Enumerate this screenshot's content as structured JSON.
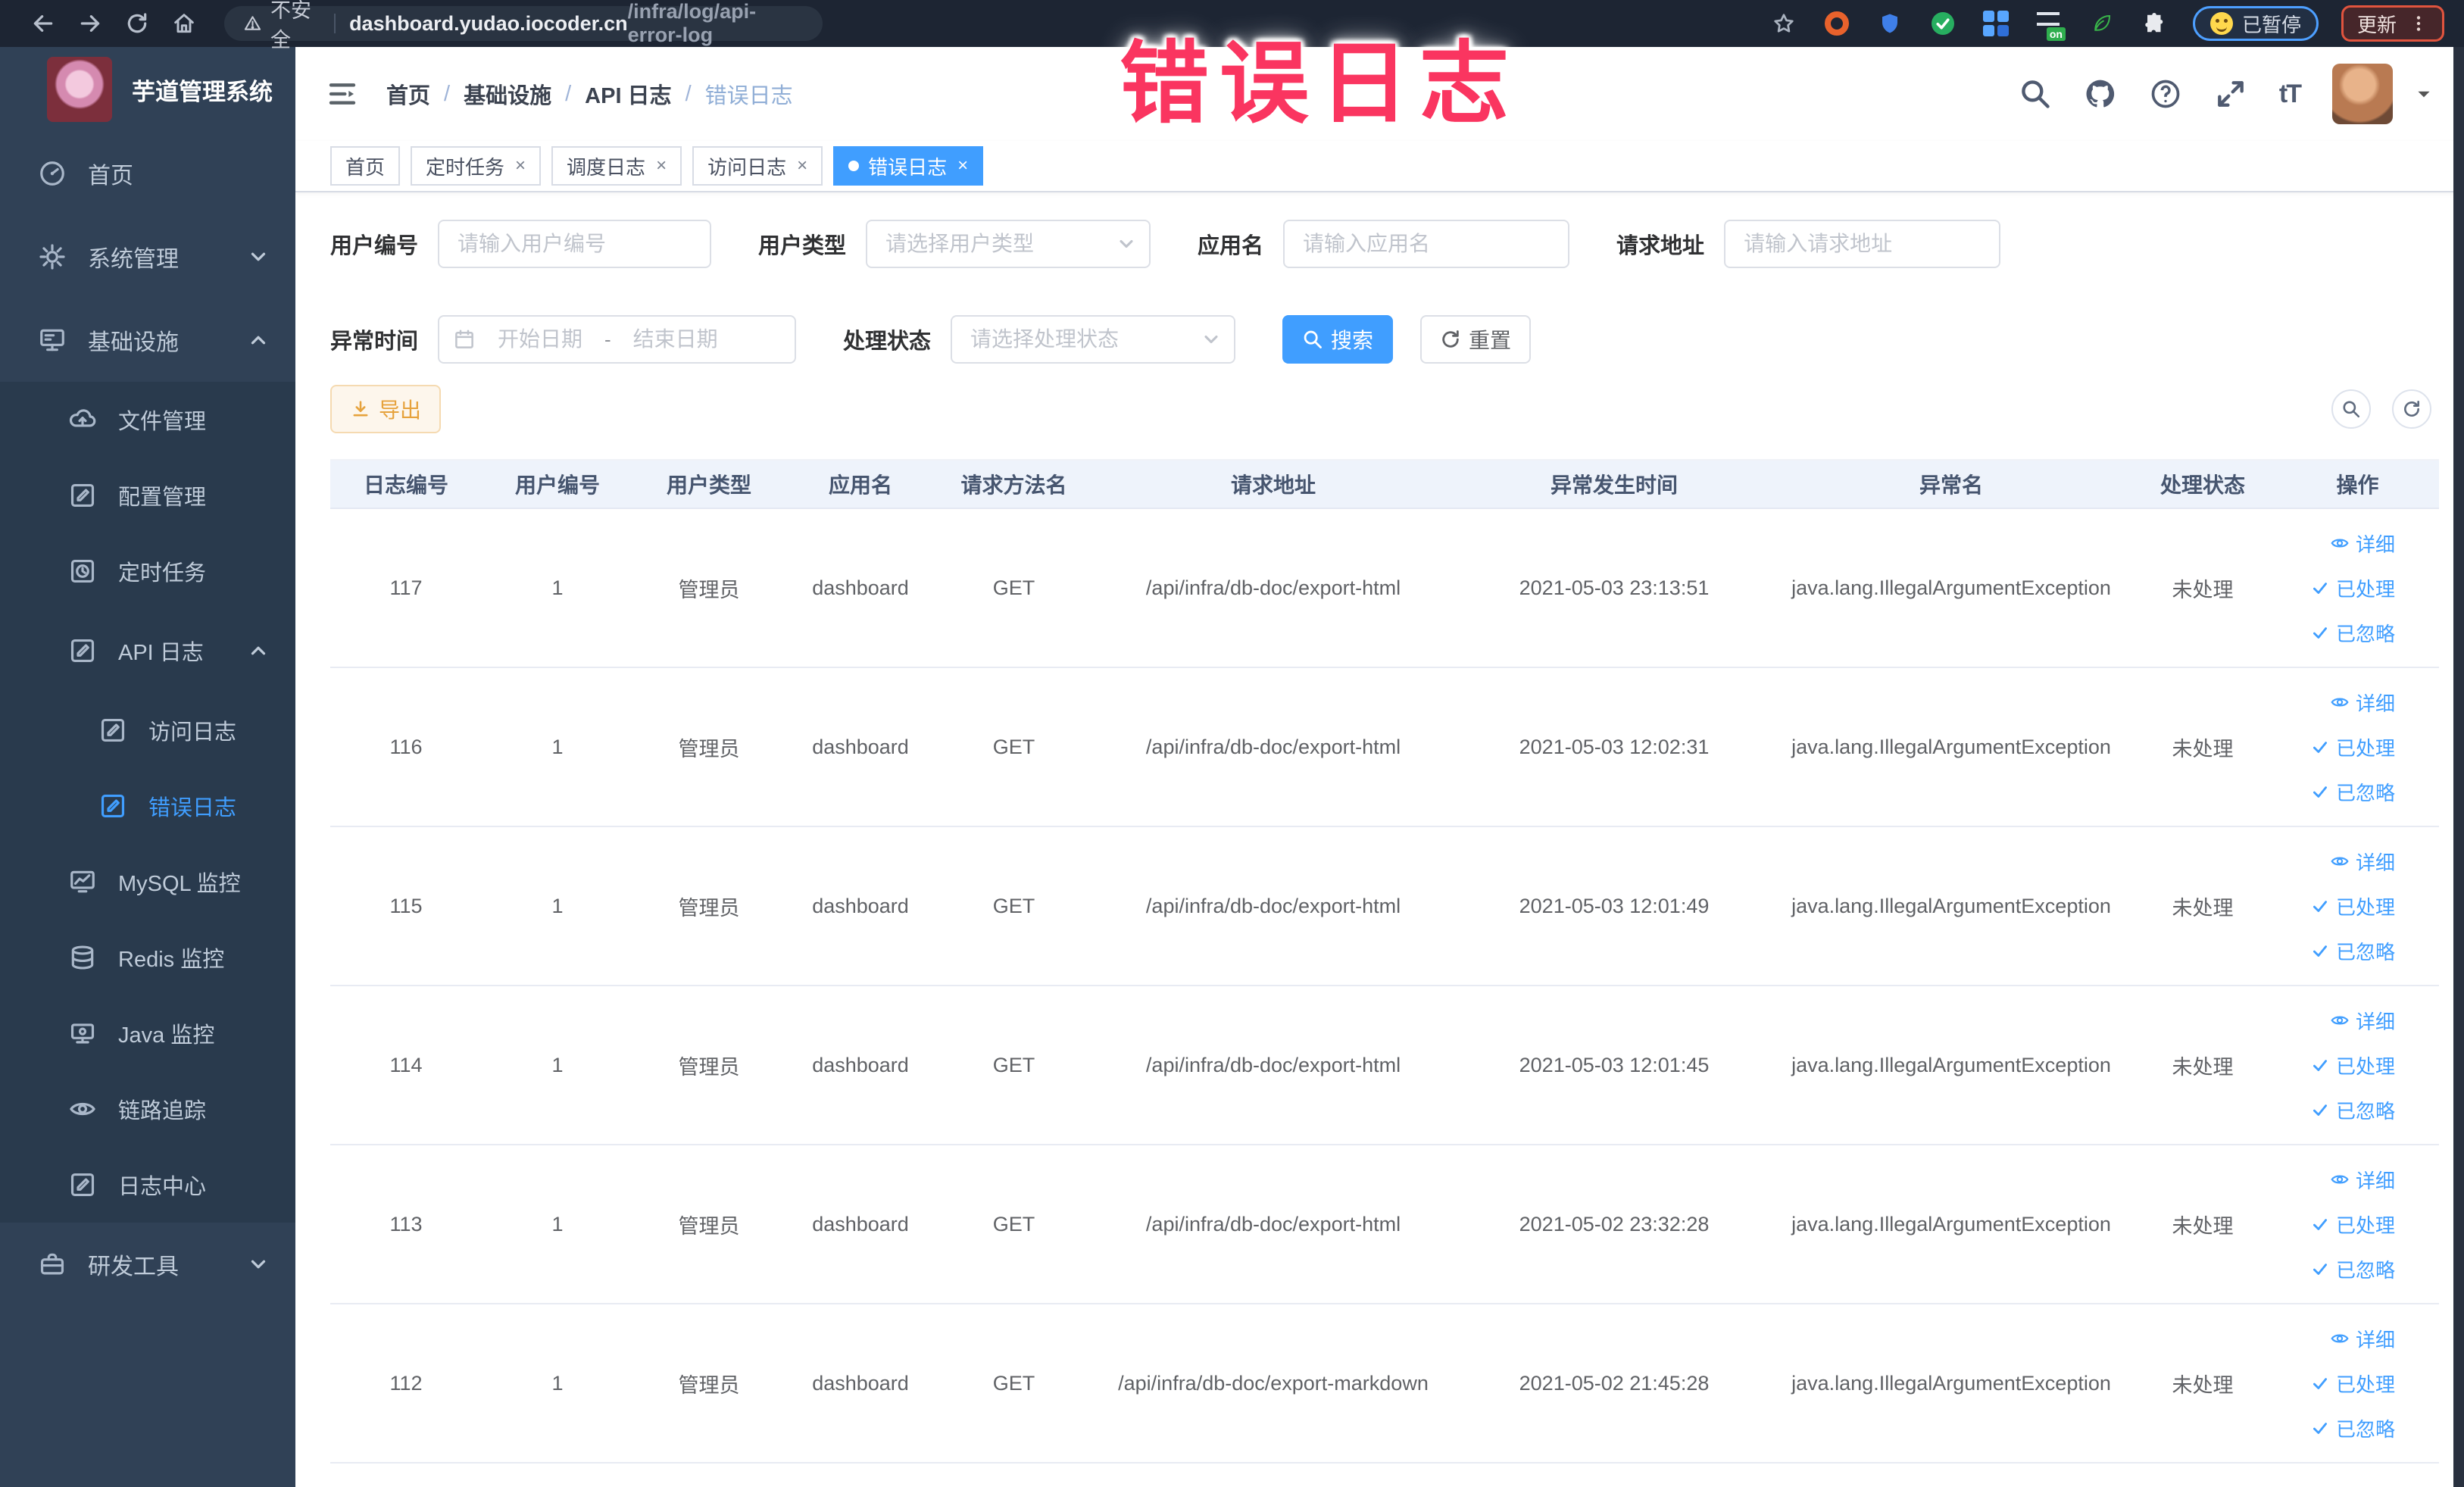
{
  "annotation": "错误日志",
  "browser": {
    "security_label": "不安全",
    "url_domain": "dashboard.yudao.iocoder.cn",
    "url_path": "/infra/log/api-error-log",
    "paused_badge": "已暂停",
    "update_label": "更新"
  },
  "sidebar": {
    "title": "芋道管理系统",
    "items": [
      {
        "label": "首页"
      },
      {
        "label": "系统管理"
      },
      {
        "label": "基础设施"
      },
      {
        "label": "文件管理"
      },
      {
        "label": "配置管理"
      },
      {
        "label": "定时任务"
      },
      {
        "label": "API 日志"
      },
      {
        "label": "访问日志"
      },
      {
        "label": "错误日志"
      },
      {
        "label": "MySQL 监控"
      },
      {
        "label": "Redis 监控"
      },
      {
        "label": "Java 监控"
      },
      {
        "label": "链路追踪"
      },
      {
        "label": "日志中心"
      },
      {
        "label": "研发工具"
      }
    ]
  },
  "navbar": {
    "breadcrumb": [
      "首页",
      "基础设施",
      "API 日志",
      "错误日志"
    ]
  },
  "tabs": [
    {
      "label": "首页"
    },
    {
      "label": "定时任务"
    },
    {
      "label": "调度日志"
    },
    {
      "label": "访问日志"
    },
    {
      "label": "错误日志"
    }
  ],
  "filters": {
    "user_id": {
      "label": "用户编号",
      "placeholder": "请输入用户编号"
    },
    "user_type": {
      "label": "用户类型",
      "placeholder": "请选择用户类型"
    },
    "app_name": {
      "label": "应用名",
      "placeholder": "请输入应用名"
    },
    "request_url": {
      "label": "请求地址",
      "placeholder": "请输入请求地址"
    },
    "exception_time": {
      "label": "异常时间",
      "start_placeholder": "开始日期",
      "separator": "-",
      "end_placeholder": "结束日期"
    },
    "process_status": {
      "label": "处理状态",
      "placeholder": "请选择处理状态"
    },
    "search_label": "搜索",
    "reset_label": "重置"
  },
  "toolbar": {
    "export_label": "导出"
  },
  "table": {
    "columns": [
      "日志编号",
      "用户编号",
      "用户类型",
      "应用名",
      "请求方法名",
      "请求地址",
      "异常发生时间",
      "异常名",
      "处理状态",
      "操作"
    ],
    "actions": [
      "详细",
      "已处理",
      "已忽略"
    ],
    "rows": [
      {
        "id": "117",
        "user_id": "1",
        "user_type": "管理员",
        "app": "dashboard",
        "method": "GET",
        "url": "/api/infra/db-doc/export-html",
        "time": "2021-05-03 23:13:51",
        "exception": "java.lang.IllegalArgumentException",
        "status": "未处理"
      },
      {
        "id": "116",
        "user_id": "1",
        "user_type": "管理员",
        "app": "dashboard",
        "method": "GET",
        "url": "/api/infra/db-doc/export-html",
        "time": "2021-05-03 12:02:31",
        "exception": "java.lang.IllegalArgumentException",
        "status": "未处理"
      },
      {
        "id": "115",
        "user_id": "1",
        "user_type": "管理员",
        "app": "dashboard",
        "method": "GET",
        "url": "/api/infra/db-doc/export-html",
        "time": "2021-05-03 12:01:49",
        "exception": "java.lang.IllegalArgumentException",
        "status": "未处理"
      },
      {
        "id": "114",
        "user_id": "1",
        "user_type": "管理员",
        "app": "dashboard",
        "method": "GET",
        "url": "/api/infra/db-doc/export-html",
        "time": "2021-05-03 12:01:45",
        "exception": "java.lang.IllegalArgumentException",
        "status": "未处理"
      },
      {
        "id": "113",
        "user_id": "1",
        "user_type": "管理员",
        "app": "dashboard",
        "method": "GET",
        "url": "/api/infra/db-doc/export-html",
        "time": "2021-05-02 23:32:28",
        "exception": "java.lang.IllegalArgumentException",
        "status": "未处理"
      },
      {
        "id": "112",
        "user_id": "1",
        "user_type": "管理员",
        "app": "dashboard",
        "method": "GET",
        "url": "/api/infra/db-doc/export-markdown",
        "time": "2021-05-02 21:45:28",
        "exception": "java.lang.IllegalArgumentException",
        "status": "未处理"
      }
    ]
  }
}
